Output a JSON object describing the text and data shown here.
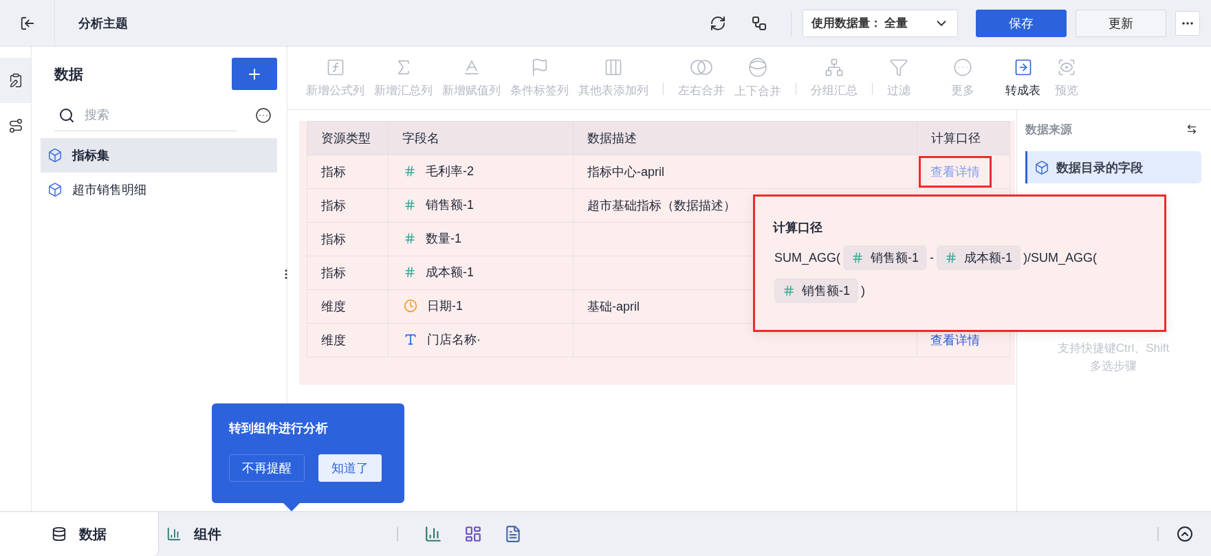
{
  "header": {
    "title": "分析主题",
    "data_usage": {
      "label": "使用数据量：",
      "value": "全量"
    },
    "buttons": [
      {
        "label": "保存",
        "kind": "primary"
      },
      {
        "label": "更新",
        "kind": "default"
      }
    ]
  },
  "side_tabs": [
    {
      "kind": "data",
      "selected": true
    },
    {
      "kind": "flow",
      "selected": false
    }
  ],
  "data_panel": {
    "title": "数据",
    "search": {
      "placeholder": "搜索"
    },
    "items": [
      {
        "label": "指标集",
        "selected": true
      },
      {
        "label": "超市销售明细",
        "selected": false
      }
    ]
  },
  "toolbar": [
    [
      {
        "label": "新增公式列",
        "kind": "formula",
        "disabled": true
      },
      {
        "label": "新增汇总列",
        "kind": "sum",
        "disabled": true
      },
      {
        "label": "新增赋值列",
        "kind": "assign",
        "disabled": true
      },
      {
        "label": "条件标签列",
        "kind": "flag",
        "disabled": true
      },
      {
        "label": "其他表添加列",
        "kind": "columns",
        "disabled": true
      }
    ],
    [
      {
        "label": "左右合并",
        "kind": "join",
        "disabled": true
      },
      {
        "label": "上下合并",
        "kind": "union",
        "disabled": true
      }
    ],
    [
      {
        "label": "分组汇总",
        "kind": "group",
        "disabled": true
      }
    ],
    [
      {
        "label": "过滤",
        "kind": "filter",
        "disabled": true
      },
      {
        "label": "更多",
        "kind": "more",
        "disabled": true
      },
      {
        "label": "转成表",
        "kind": "convert",
        "disabled": false
      },
      {
        "label": "预览",
        "kind": "preview",
        "disabled": true
      }
    ]
  ],
  "table": {
    "columns": [
      "资源类型",
      "字段名",
      "数据描述",
      "计算口径"
    ],
    "rows": [
      {
        "type": "指标",
        "field": {
          "kind": "number",
          "name": "毛利率-2"
        },
        "description": "指标中心-april",
        "link": {
          "label": "查看详情",
          "active": true
        }
      },
      {
        "type": "指标",
        "field": {
          "kind": "number",
          "name": "销售额-1"
        },
        "description": "超市基础指标（数据描述）"
      },
      {
        "type": "指标",
        "field": {
          "kind": "number",
          "name": "数量-1"
        }
      },
      {
        "type": "指标",
        "field": {
          "kind": "number",
          "name": "成本额-1"
        }
      },
      {
        "type": "维度",
        "field": {
          "kind": "date",
          "name": "日期-1"
        },
        "description": "基础-april"
      },
      {
        "type": "维度",
        "field": {
          "kind": "text",
          "name": "门店名称·"
        },
        "link": {
          "label": "查看详情",
          "active": false
        }
      }
    ]
  },
  "popover": {
    "title": "计算口径",
    "formula": [
      {
        "kind": "text",
        "text": "SUM_AGG("
      },
      {
        "kind": "field",
        "text": "销售额-1"
      },
      {
        "kind": "text",
        "text": "-"
      },
      {
        "kind": "field",
        "text": "成本额-1"
      },
      {
        "kind": "text",
        "text": ")/SUM_AGG("
      },
      {
        "kind": "field",
        "text": "销售额-1"
      },
      {
        "kind": "text",
        "text": ")"
      }
    ]
  },
  "right_panel": {
    "title": "数据来源",
    "steps": [
      {
        "label": "数据目录的字段",
        "selected": true
      }
    ],
    "hint": "支持快捷键Ctrl、Shift\n多选步骤"
  },
  "guide": {
    "title": "转到组件进行分析",
    "buttons": [
      {
        "label": "不再提醒",
        "kind": "outline"
      },
      {
        "label": "知道了",
        "kind": "filled"
      }
    ]
  },
  "bottom_tabs": [
    {
      "label": "数据",
      "kind": "data",
      "selected": true
    },
    {
      "label": "组件",
      "kind": "component",
      "selected": false
    }
  ]
}
